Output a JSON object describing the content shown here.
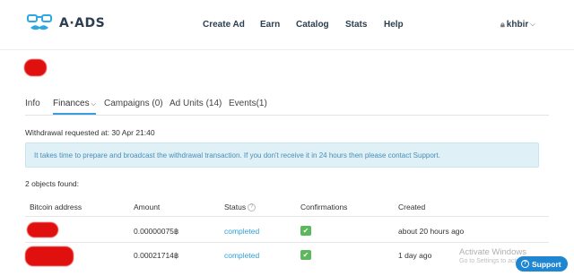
{
  "header": {
    "brand": "A·ADS",
    "nav": [
      {
        "label": "Create Ad"
      },
      {
        "label": "Earn"
      },
      {
        "label": "Catalog"
      },
      {
        "label": "Stats"
      },
      {
        "label": "Help"
      }
    ],
    "user": {
      "name": "khbir",
      "icon": "lock-icon"
    }
  },
  "tabs": [
    {
      "label": "Info"
    },
    {
      "label": "Finances"
    },
    {
      "label": "Campaigns (0)"
    },
    {
      "label": "Ad Units (14)"
    },
    {
      "label": "Events(1)"
    }
  ],
  "withdrawal_notice": "Withdrawal requested at: 30 Apr 21:40",
  "alert_text": "It takes time to prepare and broadcast the withdrawal transaction. If you don't receive it in 24 hours then please contact Support.",
  "objects_found": "2 objects found:",
  "table": {
    "headers": [
      "Bitcoin address",
      "Amount",
      "Status",
      "Confirmations",
      "Created"
    ],
    "rows": [
      {
        "amount": "0.00000075฿",
        "status": "completed",
        "created": "about 20 hours ago"
      },
      {
        "amount": "0.00021714฿",
        "status": "completed",
        "created": "1 day ago"
      }
    ]
  },
  "watermark": {
    "title": "Activate Windows",
    "subtitle": "Go to Settings to activate"
  },
  "support_button": "Support",
  "colors": {
    "accent": "#3b9ddd",
    "alert_bg": "#dff0f6",
    "confirm_green": "#5cb85c",
    "support_blue": "#1f86d1",
    "redaction": "#e0100f"
  }
}
